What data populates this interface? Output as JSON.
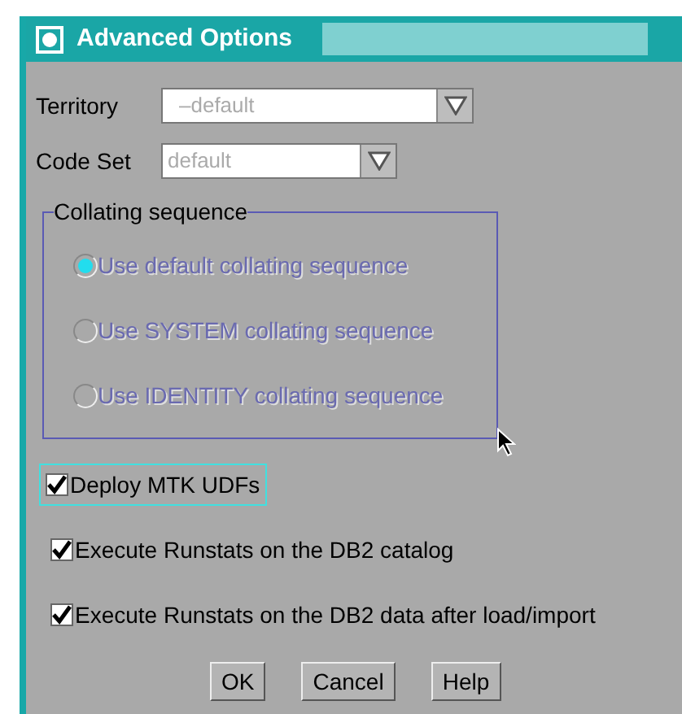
{
  "window": {
    "title": "Advanced Options"
  },
  "fields": [
    {
      "label": "Territory",
      "value": "–default",
      "disabled": true
    },
    {
      "label": "Code Set",
      "value": "default",
      "disabled": true
    }
  ],
  "collating_sequence": {
    "title": "Collating sequence",
    "disabled": true,
    "options": [
      {
        "label": "Use default collating sequence",
        "selected": true
      },
      {
        "label": "Use SYSTEM collating sequence",
        "selected": false
      },
      {
        "label": "Use IDENTITY collating sequence",
        "selected": false
      }
    ]
  },
  "checkboxes": [
    {
      "label": "Deploy MTK UDFs",
      "checked": true,
      "focused": true
    },
    {
      "label": "Execute Runstats on the DB2 catalog",
      "checked": true,
      "focused": false
    },
    {
      "label": "Execute Runstats on the DB2 data after load/import",
      "checked": true,
      "focused": false
    }
  ],
  "buttons": [
    "OK",
    "Cancel",
    "Help"
  ]
}
